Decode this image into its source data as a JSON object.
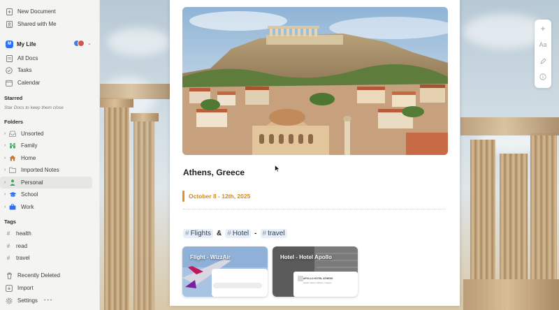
{
  "sidebar": {
    "new_document": "New Document",
    "shared_with_me": "Shared with Me",
    "workspace": {
      "badge": "M",
      "name": "My Life"
    },
    "nav": {
      "all_docs": "All Docs",
      "tasks": "Tasks",
      "calendar": "Calendar"
    },
    "starred": {
      "heading": "Starred",
      "hint": "Star Docs to keep them close"
    },
    "folders": {
      "heading": "Folders",
      "items": [
        {
          "label": "Unsorted",
          "icon": "inbox-icon",
          "color": "#8a8a8a"
        },
        {
          "label": "Family",
          "icon": "family-icon",
          "color": "#3fae5d"
        },
        {
          "label": "Home",
          "icon": "house-icon",
          "color": "#c9762e"
        },
        {
          "label": "Imported Notes",
          "icon": "folder-icon",
          "color": "#8a8a8a"
        },
        {
          "label": "Personal",
          "icon": "person-icon",
          "color": "#3aa657"
        },
        {
          "label": "School",
          "icon": "graduation-cap-icon",
          "color": "#2f6ff2"
        },
        {
          "label": "Work",
          "icon": "briefcase-icon",
          "color": "#2f6ff2"
        }
      ]
    },
    "tags": {
      "heading": "Tags",
      "items": [
        "health",
        "read",
        "travel"
      ]
    },
    "bottom": {
      "recently_deleted": "Recently Deleted",
      "import": "Import",
      "settings": "Settings"
    }
  },
  "document": {
    "title": "Athens, Greece",
    "dates": "October 8 - 12th, 2025",
    "tags_line": {
      "tag1": "Flights",
      "amp": "&",
      "tag2": "Hotel",
      "dash": "-",
      "tag3": "travel"
    },
    "cards": [
      {
        "title": "Flight - WizzAir"
      },
      {
        "title": "Hotel - Hotel Apollo",
        "inner_heading": "APOLLO HOTEL ATHENS",
        "inner_sub": "Apollo hotel in Athens, Greece"
      }
    ]
  },
  "toolbar": {
    "add": "+",
    "text": "Aa"
  },
  "colors": {
    "accent": "#e3931d",
    "active_folder_bg": "#e6e6e3",
    "brand_blue": "#2f6ff2"
  }
}
